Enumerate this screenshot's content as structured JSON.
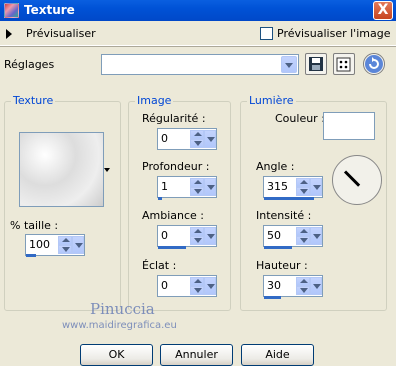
{
  "window": {
    "title": "Texture",
    "close_glyph": "X"
  },
  "preview": {
    "label": "Prévisualiser",
    "image_checkbox_label": "Prévisualiser l'image",
    "image_checked": false
  },
  "settings": {
    "label": "Réglages",
    "value": ""
  },
  "texture_group": {
    "title": "Texture",
    "size_label": "% taille :",
    "size_value": "100"
  },
  "image_group": {
    "title": "Image",
    "fields": [
      {
        "label": "Régularité :",
        "value": "0"
      },
      {
        "label": "Profondeur :",
        "value": "1"
      },
      {
        "label": "Ambiance :",
        "value": "0"
      },
      {
        "label": "Éclat :",
        "value": "0"
      }
    ]
  },
  "light_group": {
    "title": "Lumière",
    "color_label": "Couleur :",
    "angle_label": "Angle :",
    "angle_value": "315",
    "intensity_label": "Intensité :",
    "intensity_value": "50",
    "height_label": "Hauteur :",
    "height_value": "30"
  },
  "watermark": {
    "name": "Pinuccia",
    "url": "www.maidiregrafica.eu"
  },
  "buttons": {
    "ok": "OK",
    "cancel": "Annuler",
    "help": "Aide"
  }
}
